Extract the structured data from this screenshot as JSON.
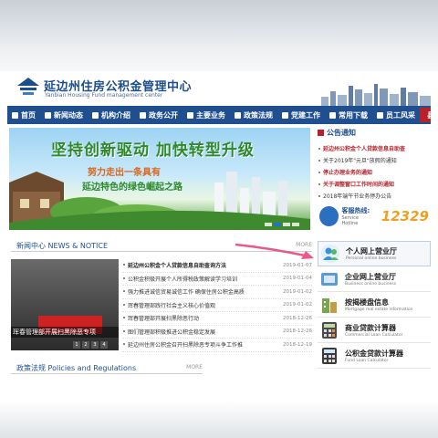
{
  "header": {
    "title_cn": "延边州住房公积金管理中心",
    "title_en": "Yanbian Housing Fund management center"
  },
  "nav": {
    "items": [
      {
        "label": "首页"
      },
      {
        "label": "新闻动态"
      },
      {
        "label": "机构介绍"
      },
      {
        "label": "政务公开"
      },
      {
        "label": "主要业务"
      },
      {
        "label": "政策法规"
      },
      {
        "label": "党建工作"
      },
      {
        "label": "常用下载"
      },
      {
        "label": "员工风采"
      }
    ],
    "end_label": "县市管理部"
  },
  "banner": {
    "headline": "坚持创新驱动  加快转型升级",
    "line1": "努力走出一条具有",
    "line2": "延边特色的绿色崛起之路"
  },
  "notice": {
    "title": "公告通知",
    "items": [
      {
        "text": "延边州公积金个人贷款信息自助查",
        "highlight": true
      },
      {
        "text": "关于2019年\"元旦\"放假的通知",
        "highlight": false
      },
      {
        "text": "停止办理业务的通知",
        "highlight": true
      },
      {
        "text": "关于调整窗口工作时间的通知",
        "highlight": true
      },
      {
        "text": "2018年端午节业务停办公告",
        "highlight": false
      }
    ]
  },
  "hotline": {
    "label": "客服热线:",
    "sub": "Service Hotline",
    "number": "12329"
  },
  "news": {
    "title": "新闻中心  NEWS & NOTICE",
    "more": "MORE",
    "image_caption": "珲春管理部开展扫黑除恶专项",
    "image_pages": [
      "1",
      "2",
      "3",
      "4"
    ],
    "items": [
      {
        "title": "延边州公积金个人贷款信息自助查询方法",
        "date": "2019-01-07",
        "bold": true
      },
      {
        "title": "公积金积极开展个人所得税政策解读学习培训",
        "date": "2019-01-04",
        "bold": false
      },
      {
        "title": "强力推进诚信贸易诚信工作  确保住房公积金高质",
        "date": "2019-01-02",
        "bold": false
      },
      {
        "title": "珲春管理部践行社会主义核心价值观",
        "date": "2019-01-02",
        "bold": false
      },
      {
        "title": "珲春管理部开展扫黑除恶行动",
        "date": "2018-12-26",
        "bold": false
      },
      {
        "title": "图们管理部积极推进公积金稳定发展",
        "date": "2018-12-26",
        "bold": false
      },
      {
        "title": "延边州住房公积金召开扫黑除恶专项斗争工作推",
        "date": "2018-12-19",
        "bold": false
      }
    ]
  },
  "policy": {
    "title": "政策法规  Policies and Regulations",
    "more": "MORE"
  },
  "services": [
    {
      "cn": "个人网上营业厅",
      "en": "Personal online business",
      "icon": "person-icon",
      "highlight": true
    },
    {
      "cn": "企业网上营业厅",
      "en": "Business online business",
      "icon": "enterprise-icon",
      "highlight": false
    },
    {
      "cn": "按揭楼盘信息",
      "en": "Mortgage real estate information",
      "icon": "building-icon",
      "highlight": false
    },
    {
      "cn": "商业贷款计算器",
      "en": "Commercial Loan Calculator",
      "icon": "calculator-icon",
      "highlight": false
    },
    {
      "cn": "公积金贷款计算器",
      "en": "Fund Loan Calculator",
      "icon": "calculator-icon",
      "highlight": false
    }
  ],
  "colors": {
    "nav_bg": "#1f4f8e",
    "accent_red": "#b8212a",
    "hotline_orange": "#f0a020"
  }
}
